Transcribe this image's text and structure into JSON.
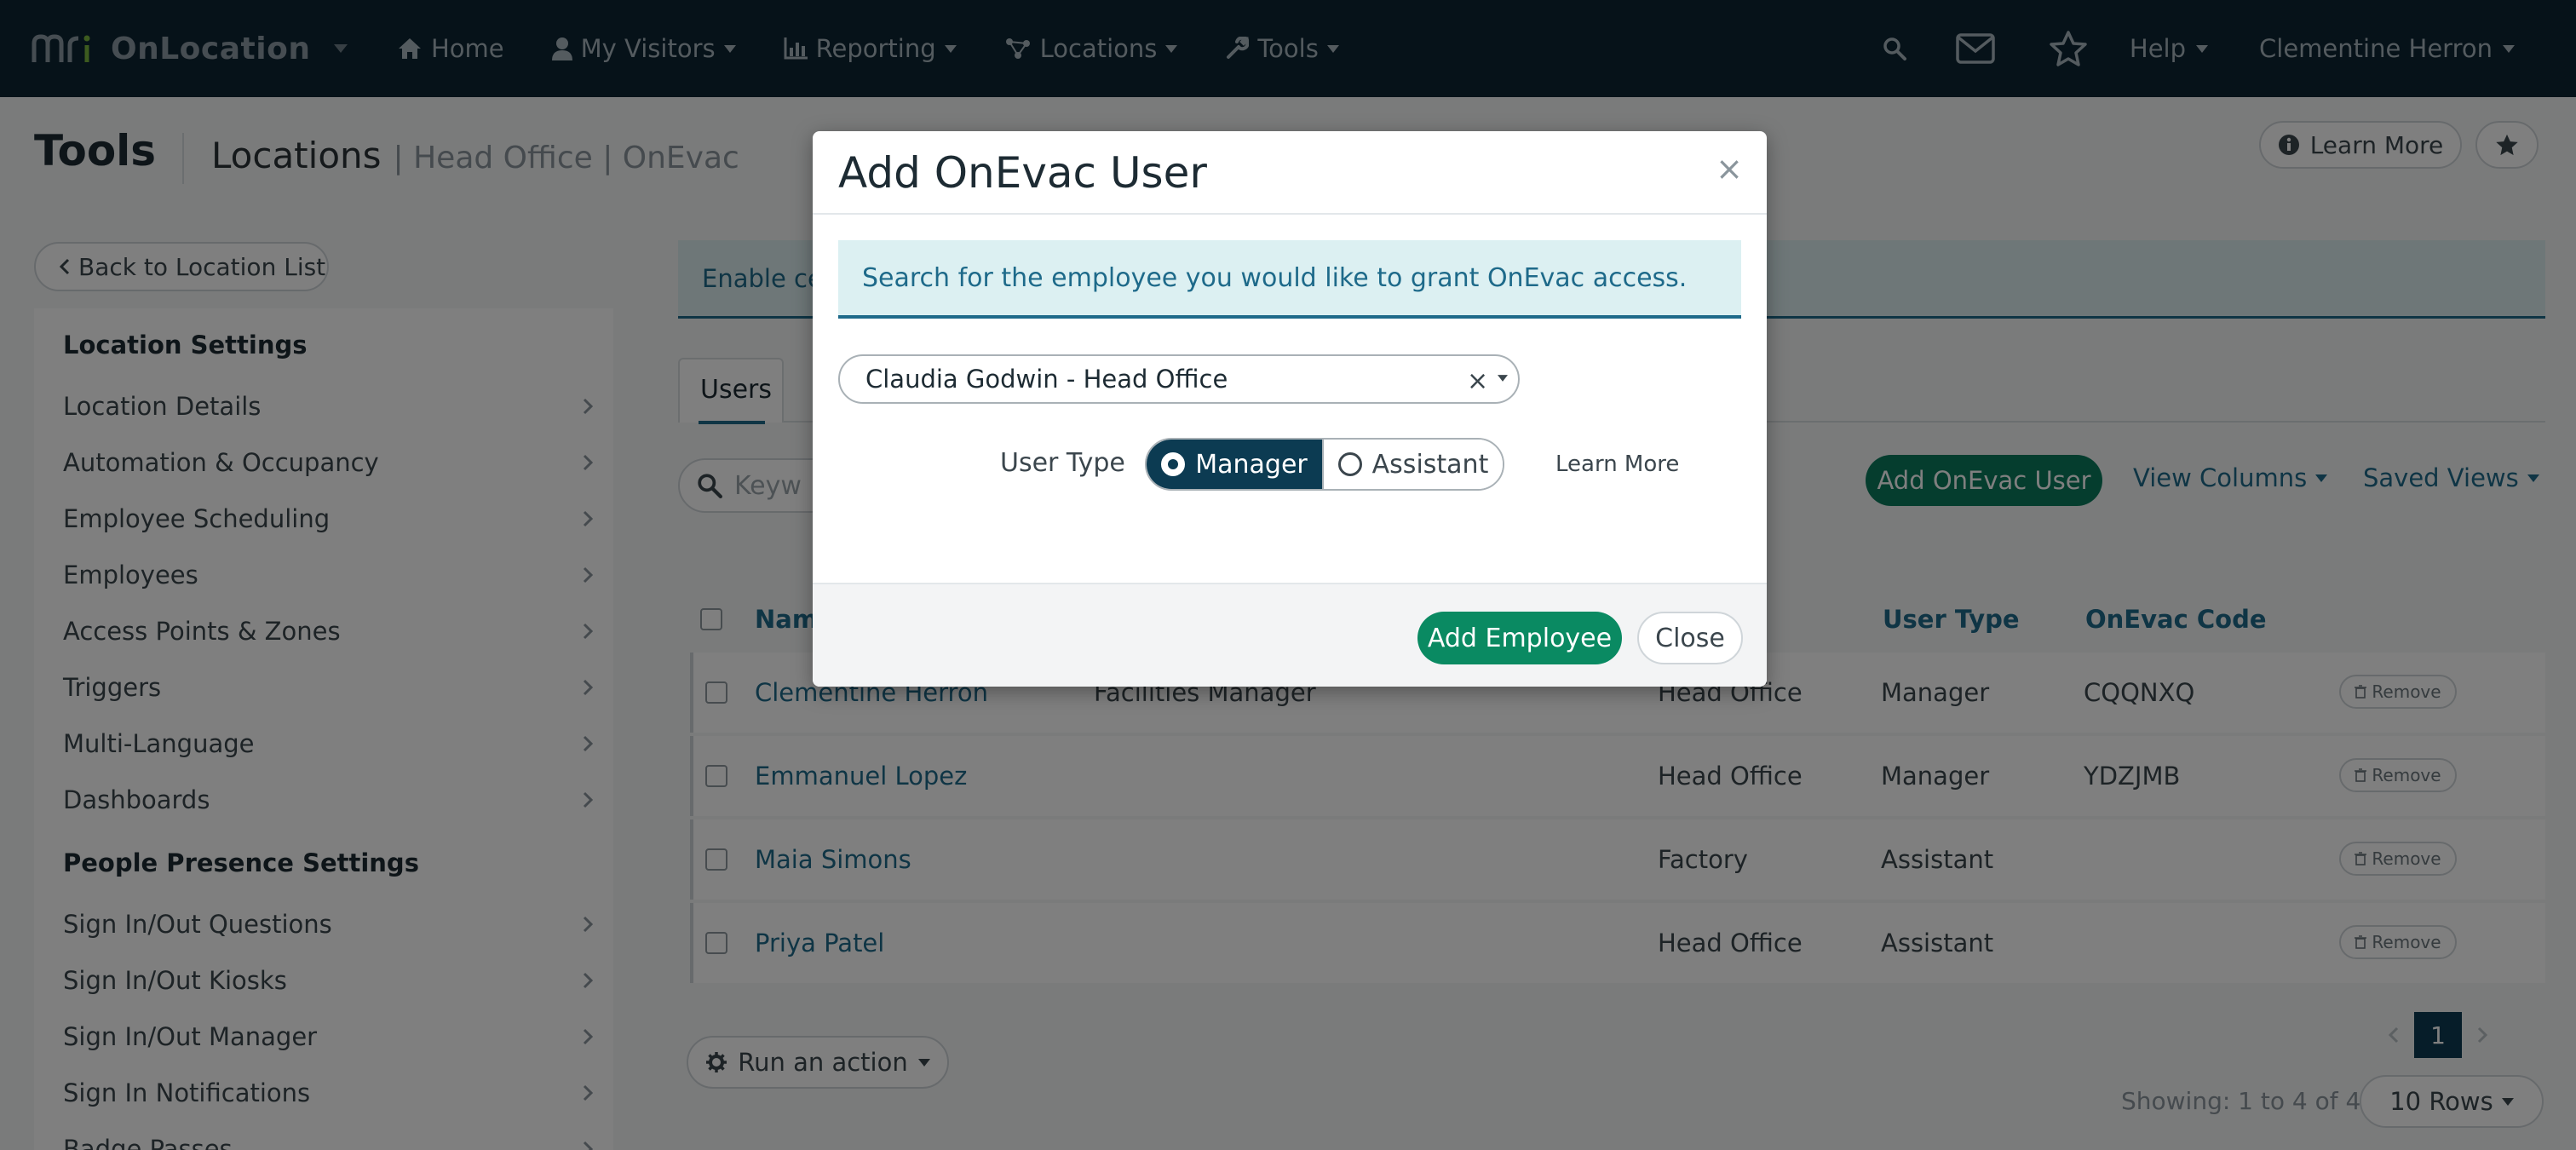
{
  "brand": {
    "logo_text": "mri",
    "name": "OnLocation"
  },
  "nav": {
    "items": [
      {
        "label": "Home",
        "icon": "home-icon"
      },
      {
        "label": "My Visitors",
        "icon": "user-icon"
      },
      {
        "label": "Reporting",
        "icon": "chart-icon"
      },
      {
        "label": "Locations",
        "icon": "locations-icon"
      },
      {
        "label": "Tools",
        "icon": "wrench-icon"
      }
    ],
    "help": "Help",
    "user": "Clementine Herron"
  },
  "header": {
    "title": "Tools",
    "breadcrumb": "Locations",
    "breadcrumb_sub": "| Head Office | OnEvac",
    "learn_more": "Learn More"
  },
  "sidebar": {
    "back": "Back to Location List",
    "section1": "Location Settings",
    "items1": [
      {
        "label": "Location Details"
      },
      {
        "label": "Automation & Occupancy"
      },
      {
        "label": "Employee Scheduling"
      },
      {
        "label": "Employees"
      },
      {
        "label": "Access Points & Zones"
      },
      {
        "label": "Triggers"
      },
      {
        "label": "Multi-Language"
      },
      {
        "label": "Dashboards"
      }
    ],
    "section2": "People Presence Settings",
    "items2": [
      {
        "label": "Sign In/Out Questions"
      },
      {
        "label": "Sign In/Out Kiosks"
      },
      {
        "label": "Sign In/Out Manager"
      },
      {
        "label": "Sign In Notifications"
      },
      {
        "label": "Badge Passes"
      }
    ]
  },
  "main": {
    "banner": "Enable ce",
    "tab": "Users",
    "search_placeholder": "Keyw",
    "add_user": "Add OnEvac User",
    "view_columns": "View Columns",
    "saved_views": "Saved Views",
    "columns": {
      "name": "Nam",
      "user_type": "User Type",
      "code": "OnEvac Code"
    },
    "remove_label": "Remove",
    "rows": [
      {
        "name": "Clementine Herron",
        "title": "Facilities Manager",
        "location": "Head Office",
        "user_type": "Manager",
        "code": "CQQNXQ"
      },
      {
        "name": "Emmanuel Lopez",
        "title": "",
        "location": "Head Office",
        "user_type": "Manager",
        "code": "YDZJMB"
      },
      {
        "name": "Maia Simons",
        "title": "",
        "location": "Factory",
        "user_type": "Assistant",
        "code": ""
      },
      {
        "name": "Priya Patel",
        "title": "",
        "location": "Head Office",
        "user_type": "Assistant",
        "code": ""
      }
    ],
    "run_action": "Run an action",
    "page": "1",
    "showing": "Showing: 1 to 4 of 4",
    "rows_per_page": "10 Rows"
  },
  "modal": {
    "title": "Add OnEvac User",
    "close_x": "×",
    "info": "Search for the employee you would like to grant OnEvac access.",
    "selected_employee": "Claudia Godwin - Head Office",
    "clear": "×",
    "user_type_label": "User Type",
    "options": [
      "Manager",
      "Assistant"
    ],
    "selected_option": "Manager",
    "learn_more": "Learn More",
    "add_button": "Add Employee",
    "close_button": "Close"
  },
  "colors": {
    "navbar": "#0c2432",
    "accent": "#1e6a8a",
    "primary_green": "#0a8a62",
    "toggle_active": "#0c3b52"
  }
}
